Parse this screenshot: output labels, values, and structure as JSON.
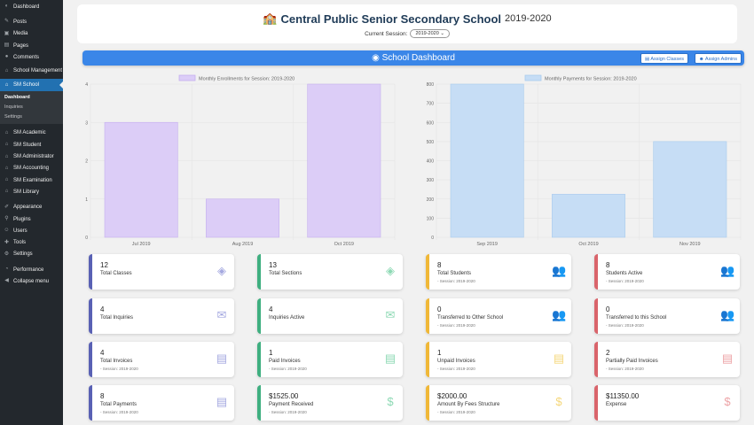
{
  "sidebar": {
    "items_top": [
      {
        "label": "Dashboard",
        "icon": "dashboard-icon"
      },
      {
        "label": "Posts",
        "icon": "pin-icon"
      },
      {
        "label": "Media",
        "icon": "media-icon"
      },
      {
        "label": "Pages",
        "icon": "page-icon"
      },
      {
        "label": "Comments",
        "icon": "comment-icon"
      },
      {
        "label": "School Management",
        "icon": "school-icon"
      },
      {
        "label": "SM School",
        "icon": "school-icon"
      }
    ],
    "submenu": [
      "Dashboard",
      "Inquiries",
      "Settings"
    ],
    "items_mid": [
      {
        "label": "SM Academic",
        "icon": "school-icon"
      },
      {
        "label": "SM Student",
        "icon": "school-icon"
      },
      {
        "label": "SM Administrator",
        "icon": "school-icon"
      },
      {
        "label": "SM Accounting",
        "icon": "school-icon"
      },
      {
        "label": "SM Examination",
        "icon": "school-icon"
      },
      {
        "label": "SM Library",
        "icon": "school-icon"
      }
    ],
    "items_bottom": [
      {
        "label": "Appearance",
        "icon": "brush-icon"
      },
      {
        "label": "Plugins",
        "icon": "plugin-icon"
      },
      {
        "label": "Users",
        "icon": "user-icon"
      },
      {
        "label": "Tools",
        "icon": "wrench-icon"
      },
      {
        "label": "Settings",
        "icon": "settings-icon"
      }
    ],
    "items_end": [
      {
        "label": "Performance",
        "icon": "gauge-icon"
      },
      {
        "label": "Collapse menu",
        "icon": "collapse-icon"
      }
    ]
  },
  "header": {
    "school_name": "Central Public Senior Secondary School",
    "year": "2019-2020",
    "session_label": "Current Session:",
    "session_value": "2019-2020"
  },
  "dashboard": {
    "title": "School Dashboard",
    "assign_classes": "Assign Classes",
    "assign_admins": "Assign Admins"
  },
  "chart_data": [
    {
      "type": "bar",
      "legend": "Monthly Enrollments for Session: 2019-2020",
      "categories": [
        "Jul 2019",
        "Aug 2019",
        "Oct 2019"
      ],
      "values": [
        3,
        1,
        4
      ],
      "ylim": [
        0,
        4
      ],
      "yticks": [
        0,
        1,
        2,
        3,
        4
      ],
      "color": "#dccdf7",
      "border": "#c5b0ef"
    },
    {
      "type": "bar",
      "legend": "Monthly Payments for Session: 2019-2020",
      "categories": [
        "Sep 2019",
        "Oct 2019",
        "Nov 2019"
      ],
      "values": [
        800,
        225,
        500
      ],
      "ylim": [
        0,
        800
      ],
      "yticks": [
        0,
        100,
        200,
        300,
        400,
        500,
        600,
        700,
        800
      ],
      "color": "#c6ddf5",
      "border": "#a9cbee"
    }
  ],
  "cards": [
    {
      "value": "12",
      "label": "Total Classes",
      "sub": "",
      "color": "blue",
      "icon": "layers-icon"
    },
    {
      "value": "13",
      "label": "Total Sections",
      "sub": "",
      "color": "green",
      "icon": "layers-icon"
    },
    {
      "value": "8",
      "label": "Total Students",
      "sub": "- Session: 2019-2020",
      "color": "yellow",
      "icon": "users-icon"
    },
    {
      "value": "8",
      "label": "Students Active",
      "sub": "- Session: 2019-2020",
      "color": "red",
      "icon": "users-icon"
    },
    {
      "value": "4",
      "label": "Total Inquiries",
      "sub": "",
      "color": "blue",
      "icon": "envelope-icon"
    },
    {
      "value": "4",
      "label": "Inquiries Active",
      "sub": "",
      "color": "green",
      "icon": "envelope-icon"
    },
    {
      "value": "0",
      "label": "Transferred to Other School",
      "sub": "- Session: 2019-2020",
      "color": "yellow",
      "icon": "users-icon"
    },
    {
      "value": "0",
      "label": "Transferred to this School",
      "sub": "- Session: 2019-2020",
      "color": "red",
      "icon": "users-icon"
    },
    {
      "value": "4",
      "label": "Total Invoices",
      "sub": "- Session: 2019-2020",
      "color": "blue",
      "icon": "invoice-icon"
    },
    {
      "value": "1",
      "label": "Paid Invoices",
      "sub": "- Session: 2019-2020",
      "color": "green",
      "icon": "invoice-icon"
    },
    {
      "value": "1",
      "label": "Unpaid Invoices",
      "sub": "- Session: 2019-2020",
      "color": "yellow",
      "icon": "invoice-icon"
    },
    {
      "value": "2",
      "label": "Partially Paid Invoices",
      "sub": "- Session: 2019-2020",
      "color": "red",
      "icon": "invoice-icon"
    },
    {
      "value": "8",
      "label": "Total Payments",
      "sub": "- Session: 2019-2020",
      "color": "blue",
      "icon": "invoice-icon"
    },
    {
      "value": "$1525.00",
      "label": "Payment Received",
      "sub": "- Session: 2019-2020",
      "color": "green",
      "icon": "dollar-icon"
    },
    {
      "value": "$2000.00",
      "label": "Amount By Fees Structure",
      "sub": "- Session: 2019-2020",
      "color": "yellow",
      "icon": "dollar-icon"
    },
    {
      "value": "$11350.00",
      "label": "Expense",
      "sub": "",
      "color": "red",
      "icon": "dollar-icon"
    }
  ]
}
